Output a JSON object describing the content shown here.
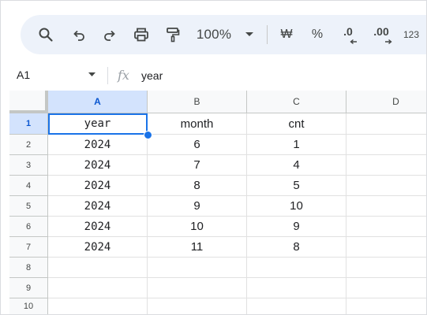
{
  "toolbar": {
    "zoom": "100%",
    "currency_symbol": "₩",
    "percent_symbol": "%",
    "decrease_decimal": ".0",
    "increase_decimal": ".00",
    "more_formats": "123"
  },
  "formula_bar": {
    "name_box": "A1",
    "fx": "fx",
    "content": "year"
  },
  "columns": [
    "A",
    "B",
    "C",
    "D"
  ],
  "rows": [
    "1",
    "2",
    "3",
    "4",
    "5",
    "6",
    "7",
    "8",
    "9",
    "10"
  ],
  "cells": [
    [
      "year",
      "month",
      "cnt"
    ],
    [
      "2024",
      "6",
      "1"
    ],
    [
      "2024",
      "7",
      "4"
    ],
    [
      "2024",
      "8",
      "5"
    ],
    [
      "2024",
      "9",
      "10"
    ],
    [
      "2024",
      "10",
      "9"
    ],
    [
      "2024",
      "11",
      "8"
    ]
  ],
  "selection": {
    "cell": "A1"
  },
  "colors": {
    "accent": "#1a73e8",
    "selected_header_bg": "#d3e3fd",
    "toolbar_bg": "#edf2fa"
  }
}
